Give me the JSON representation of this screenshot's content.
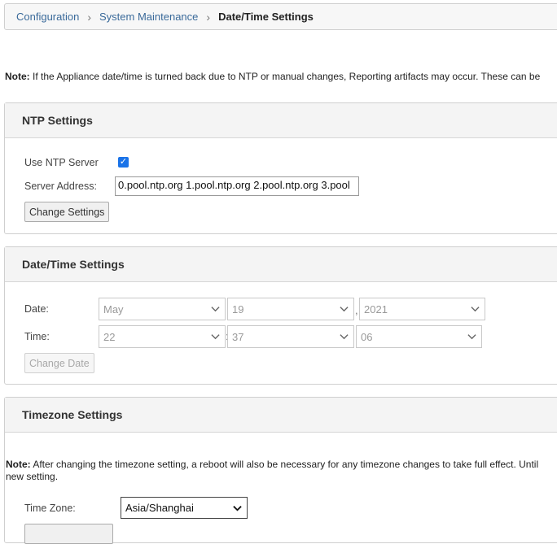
{
  "breadcrumb": {
    "items": [
      "Configuration",
      "System Maintenance"
    ],
    "current": "Date/Time Settings"
  },
  "note1": {
    "label": "Note:",
    "text": " If the Appliance date/time is turned back due to NTP or manual changes, Reporting artifacts may occur. These can be"
  },
  "ntp": {
    "title": "NTP Settings",
    "use_label": "Use NTP Server",
    "use_checked": true,
    "server_label": "Server Address:",
    "server_value": "0.pool.ntp.org 1.pool.ntp.org 2.pool.ntp.org 3.pool",
    "button": "Change Settings"
  },
  "datetime": {
    "title": "Date/Time Settings",
    "date_label": "Date:",
    "month": "May",
    "day": "19",
    "year": "2021",
    "time_label": "Time:",
    "hour": "22",
    "minute": "37",
    "second": "06",
    "date_sep": ",",
    "time_sep": ":",
    "button": "Change Date"
  },
  "timezone": {
    "title": "Timezone Settings",
    "note_label": "Note:",
    "note_text": " After changing the timezone setting, a reboot will also be necessary for any timezone changes to take full effect. Until",
    "note_text2": "new setting.",
    "tz_label": "Time Zone:",
    "tz_value": "Asia/Shanghai"
  }
}
